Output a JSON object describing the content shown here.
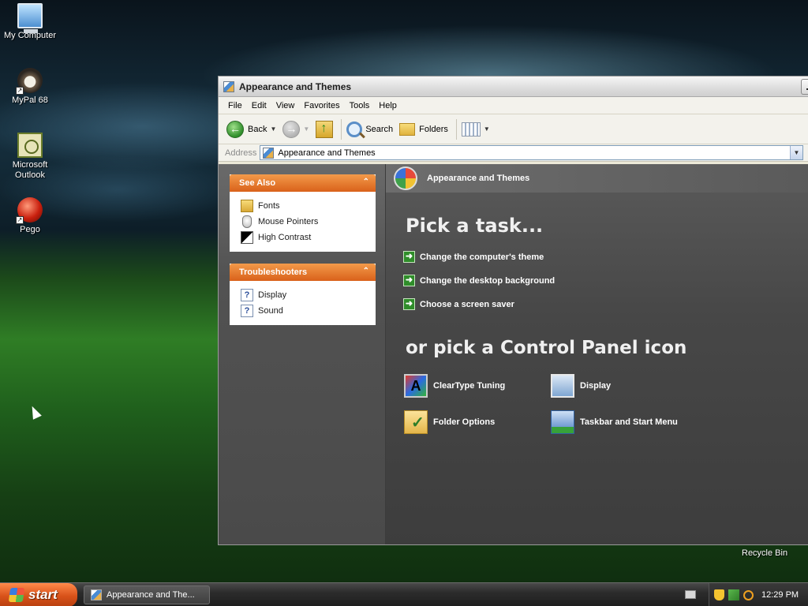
{
  "desktop": {
    "icons": [
      {
        "label": "My Computer",
        "icon": "computer-icon"
      },
      {
        "label": "MyPal 68",
        "icon": "mypal-icon"
      },
      {
        "label": "Microsoft Outlook",
        "icon": "outlook-icon"
      },
      {
        "label": "Pego",
        "icon": "pego-icon"
      }
    ],
    "recycle_bin": "Recycle Bin"
  },
  "window": {
    "title": "Appearance and Themes",
    "menu": [
      "File",
      "Edit",
      "View",
      "Favorites",
      "Tools",
      "Help"
    ],
    "toolbar": {
      "back": "Back",
      "search": "Search",
      "folders": "Folders"
    },
    "address": {
      "label": "Address",
      "value": "Appearance and Themes"
    },
    "see_also": {
      "title": "See Also",
      "links": [
        "Fonts",
        "Mouse Pointers",
        "High Contrast"
      ]
    },
    "troubleshooters": {
      "title": "Troubleshooters",
      "links": [
        "Display",
        "Sound"
      ]
    },
    "main": {
      "header": "Appearance and Themes",
      "pick_task": "Pick a task...",
      "tasks": [
        "Change the computer's theme",
        "Change the desktop background",
        "Choose a screen saver"
      ],
      "pick_icon": "or pick a Control Panel icon",
      "icons": [
        "ClearType Tuning",
        "Display",
        "Folder Options",
        "Taskbar and Start Menu"
      ]
    }
  },
  "taskbar": {
    "start": "start",
    "task_button": "Appearance and The...",
    "clock": "12:29 PM"
  },
  "colors": {
    "accent_orange": "#d9611a",
    "task_green": "#2f8d2a"
  }
}
